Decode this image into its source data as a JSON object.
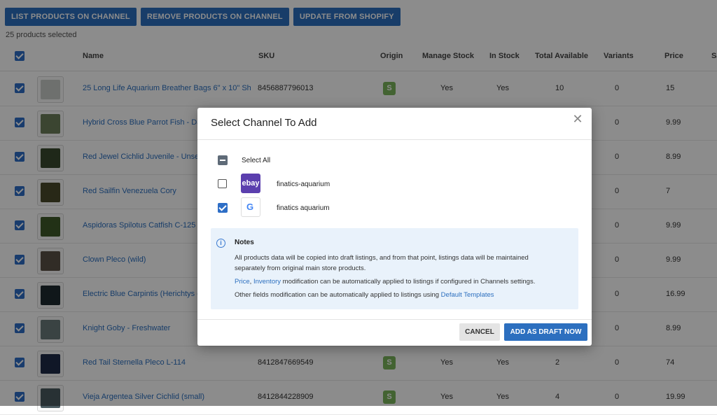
{
  "toolbar": {
    "list_label": "LIST PRODUCTS ON CHANNEL",
    "remove_label": "REMOVE PRODUCTS ON CHANNEL",
    "update_label": "UPDATE FROM SHOPIFY"
  },
  "selected_count": "25 products selected",
  "table": {
    "headers": [
      "Name",
      "SKU",
      "Origin",
      "Manage Stock",
      "In Stock",
      "Total Available",
      "Variants",
      "Price",
      "Sa"
    ],
    "rows": [
      {
        "name": "25 Long Life Aquarium Breather Bags 6\" x 10\" Sh...",
        "sku": "8456887796013",
        "manage": "Yes",
        "instock": "Yes",
        "total": "10",
        "variants": "0",
        "price": "15",
        "thumb_color": "#c8ccc8"
      },
      {
        "name": "Hybrid Cross Blue Parrot Fish - Dac",
        "sku": "",
        "manage": "",
        "instock": "",
        "total": "",
        "variants": "0",
        "price": "9.99",
        "thumb_color": "#6c7f5a"
      },
      {
        "name": "Red Jewel Cichlid Juvenile - Unsex",
        "sku": "",
        "manage": "",
        "instock": "",
        "total": "",
        "variants": "0",
        "price": "8.99",
        "thumb_color": "#3a4a2e"
      },
      {
        "name": "Red Sailfin Venezuela Cory",
        "sku": "",
        "manage": "",
        "instock": "",
        "total": "",
        "variants": "0",
        "price": "7",
        "thumb_color": "#4a4a2a"
      },
      {
        "name": "Aspidoras Spilotus Catfish C-125",
        "sku": "",
        "manage": "",
        "instock": "",
        "total": "",
        "variants": "0",
        "price": "9.99",
        "thumb_color": "#3e5a28"
      },
      {
        "name": "Clown Pleco (wild)",
        "sku": "",
        "manage": "",
        "instock": "",
        "total": "",
        "variants": "0",
        "price": "9.99",
        "thumb_color": "#5a5046"
      },
      {
        "name": "Electric Blue Carpintis (Herichtys c",
        "sku": "",
        "manage": "",
        "instock": "",
        "total": "",
        "variants": "0",
        "price": "16.99",
        "thumb_color": "#1e2a30"
      },
      {
        "name": "Knight Goby - Freshwater",
        "sku": "",
        "manage": "",
        "instock": "",
        "total": "",
        "variants": "0",
        "price": "8.99",
        "thumb_color": "#6a7a7a"
      },
      {
        "name": "Red Tail Sternella Pleco L-114",
        "sku": "8412847669549",
        "manage": "Yes",
        "instock": "Yes",
        "total": "2",
        "variants": "0",
        "price": "74",
        "thumb_color": "#1e2a48"
      },
      {
        "name": "Vieja Argentea Silver Cichlid (small)",
        "sku": "8412844228909",
        "manage": "Yes",
        "instock": "Yes",
        "total": "4",
        "variants": "0",
        "price": "19.99",
        "thumb_color": "#4a5a60"
      }
    ]
  },
  "modal": {
    "title": "Select Channel To Add",
    "select_all": "Select All",
    "channels": [
      {
        "name": "finatics-aquarium",
        "icon": "ebay-icon",
        "logo_text": "ebay",
        "checked": false
      },
      {
        "name": "finatics aquarium",
        "icon": "google-icon",
        "logo_text": "G",
        "checked": true
      }
    ],
    "notes": {
      "title": "Notes",
      "line1": "All products data will be copied into draft listings, and from that point, listings data will be maintained",
      "line2": "separately from original main store products.",
      "price_link": "Price",
      "comma": ", ",
      "inventory_link": "Inventory",
      "line3_rest": " modification can be automatically applied to listings if configured in Channels settings.",
      "line4": "Other fields modification can be automatically applied to listings using ",
      "templates_link": "Default Templates"
    },
    "cancel_label": "CANCEL",
    "add_label": "ADD AS DRAFT NOW"
  },
  "colors": {
    "accent": "#2c6fbf",
    "shopify": "#7ab55c",
    "ebay": "#5b3fae",
    "notes_bg": "#e9f2fb"
  }
}
